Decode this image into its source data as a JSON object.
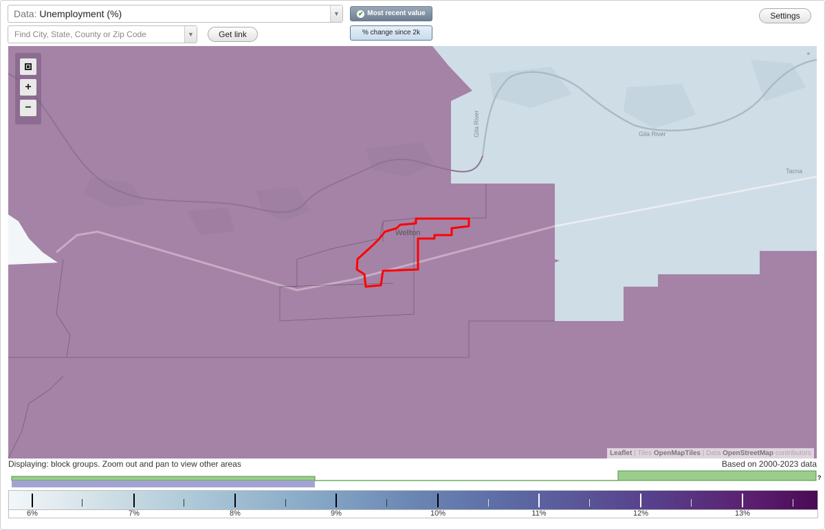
{
  "controls": {
    "data_select_prefix": "Data:",
    "data_select_value": "Unemployment (%)",
    "search_placeholder": "Find City, State, County or Zip Code",
    "get_link_label": "Get link",
    "settings_label": "Settings",
    "mode_most_recent_label": "Most recent value",
    "mode_change_label": "% change since 2k"
  },
  "map": {
    "zoom_fit_icon": "fit-bounds-icon",
    "zoom_in_label": "+",
    "zoom_out_label": "−",
    "place_labels": {
      "wellton": "Wellton",
      "tacna": "Tacna",
      "gila_river": "Gila River",
      "gila_river_vertical": "Gila River"
    },
    "attribution": {
      "leaflet": "Leaflet",
      "tiles_prefix": "Tiles",
      "tiles_name": "OpenMapTiles",
      "data_prefix": "Data",
      "data_name": "OpenStreetMap",
      "data_suffix": "contributors"
    },
    "colors": {
      "high_fill": "#a583a6",
      "low_fill": "#cfdde7",
      "selected_outline": "#ff0000"
    }
  },
  "footer": {
    "display_note": "Displaying: block groups. Zoom out and pan to view other areas",
    "based_on": "Based on 2000-2023 data",
    "histogram_help": "?"
  },
  "legend": {
    "tick_labels": [
      "6%",
      "7%",
      "8%",
      "9%",
      "10%",
      "11%",
      "12%",
      "13%"
    ]
  }
}
